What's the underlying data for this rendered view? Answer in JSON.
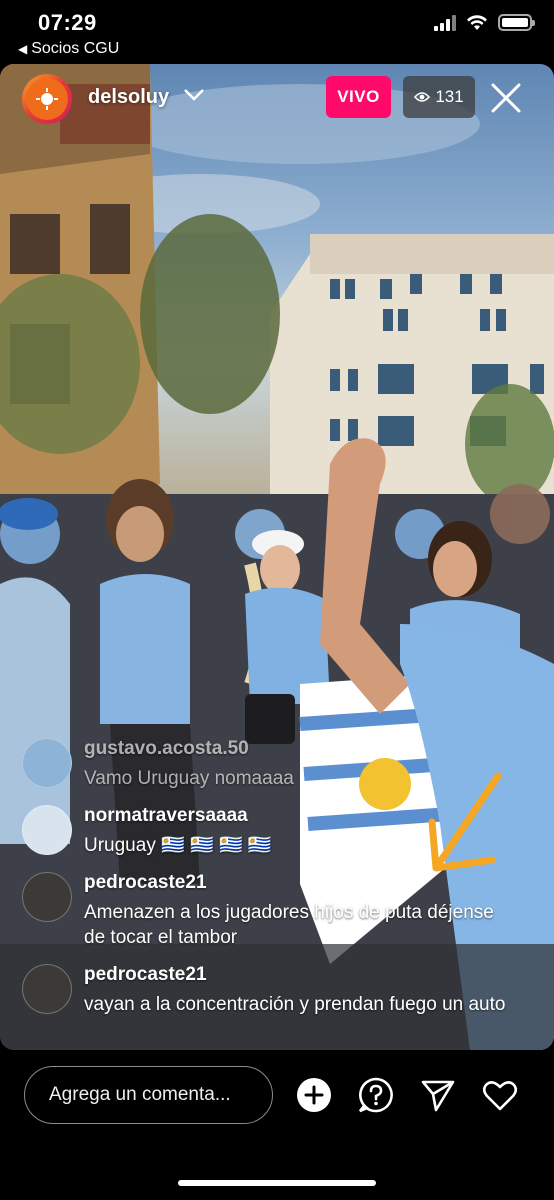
{
  "status_bar": {
    "time": "07:29",
    "back_app": "Socios CGU",
    "back_arrow": "◀"
  },
  "live": {
    "username": "delsoluy",
    "live_label": "VIVO",
    "viewer_count": "131",
    "icons": {
      "dropdown": "chevron-down-icon",
      "viewers": "eye-icon",
      "close": "close-icon"
    }
  },
  "comments": [
    {
      "user": "gustavo.acosta.50",
      "text": "Vamo Uruguay nomaaaa"
    },
    {
      "user": "normatraversaaaa",
      "text": "Uruguay 🇺🇾 🇺🇾 🇺🇾 🇺🇾"
    },
    {
      "user": "pedrocaste21",
      "text": "Amenazen a los jugadores hijos de puta déjense de tocar el tambor"
    },
    {
      "user": "pedrocaste21",
      "text": "vayan a la concentración y prendan fuego un auto"
    }
  ],
  "bottom_bar": {
    "comment_placeholder": "Agrega un comenta...",
    "icons": [
      "add-icon",
      "question-icon",
      "send-icon",
      "heart-icon"
    ]
  },
  "colors": {
    "live_badge": "#ff0a6a",
    "annotation_arrow": "#f5a623"
  }
}
